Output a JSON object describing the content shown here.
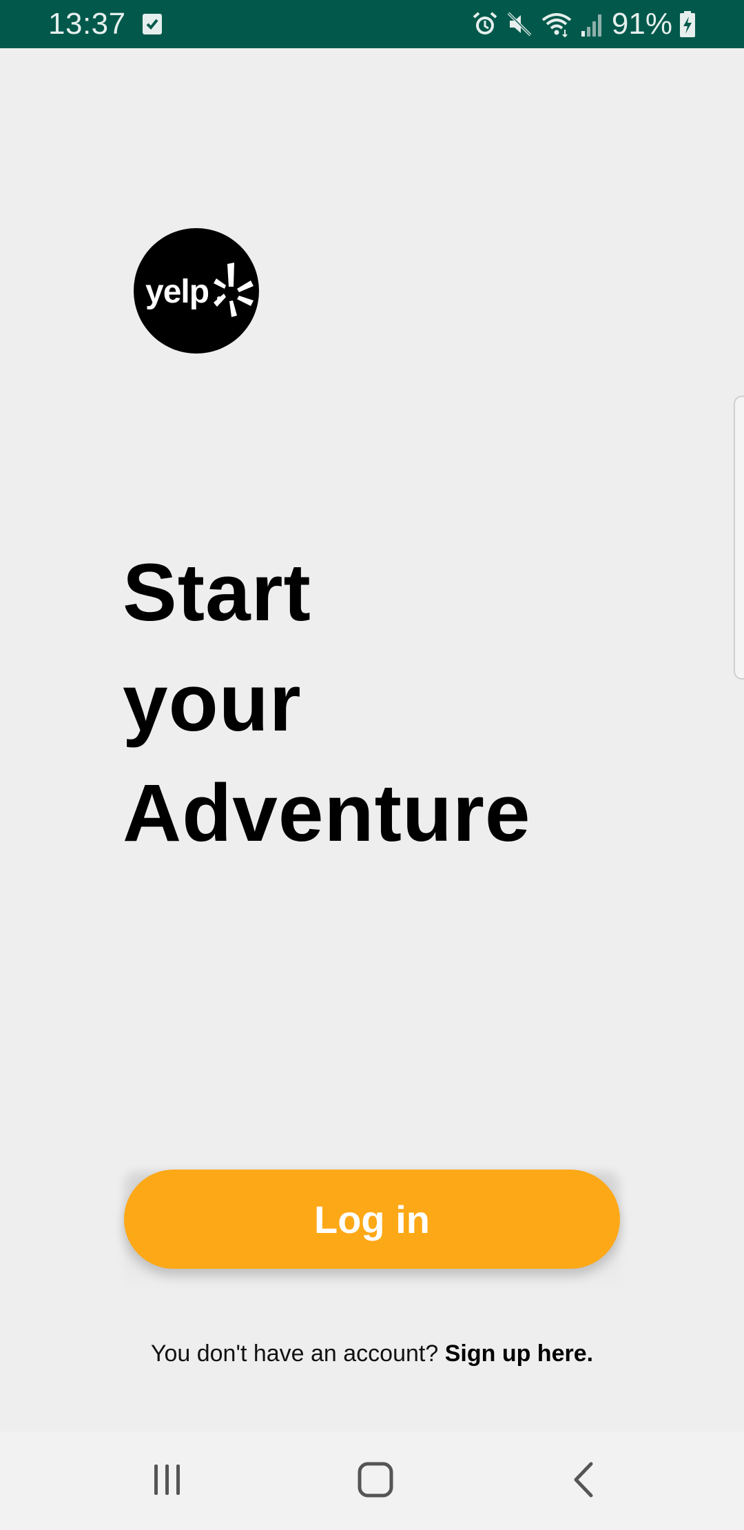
{
  "status_bar": {
    "time": "13:37",
    "battery_percent": "91%",
    "icons": [
      "checkbox-notification-icon",
      "alarm-icon",
      "mute-icon",
      "wifi-icon",
      "signal-icon",
      "battery-charging-icon"
    ],
    "background_color": "#02594b"
  },
  "logo": {
    "text": "yelp",
    "icon": "yelp-burst-icon"
  },
  "headline": {
    "line1": "Start",
    "line2": "your",
    "line3": "Adventure"
  },
  "login": {
    "label": "Log in",
    "color": "#fda816"
  },
  "signup": {
    "prompt": "You don't have an account? ",
    "link": "Sign up here."
  },
  "navigation_bar": {
    "buttons": [
      "recent-apps-icon",
      "home-icon",
      "back-icon"
    ]
  }
}
